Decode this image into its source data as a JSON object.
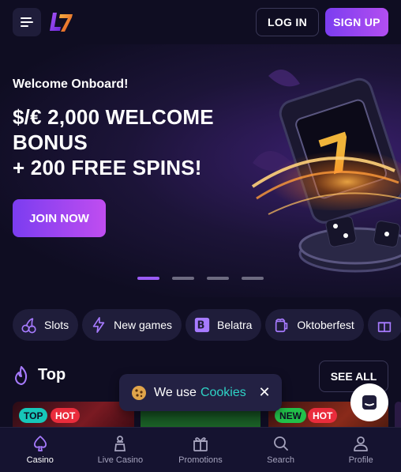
{
  "header": {
    "menu_icon": "hamburger-icon",
    "logo_text": "L7",
    "login_label": "LOG IN",
    "signup_label": "SIGN UP"
  },
  "hero": {
    "subtitle": "Welcome Onboard!",
    "title_line1": "$/€ 2,000 WELCOME",
    "title_line2": "BONUS",
    "title_line3": "+ 200 FREE SPINS!",
    "cta_label": "JOIN NOW",
    "slides_total": 4,
    "active_slide": 1
  },
  "categories": [
    {
      "label": "Slots",
      "icon": "cherries-icon"
    },
    {
      "label": "New games",
      "icon": "lightning-icon"
    },
    {
      "label": "Belatra",
      "icon": "belatra-logo-icon"
    },
    {
      "label": "Oktoberfest",
      "icon": "beer-mug-icon"
    },
    {
      "label": "",
      "icon": "gift-icon"
    }
  ],
  "top_section": {
    "title": "Top",
    "see_all_label": "SEE ALL",
    "cards": [
      {
        "badges": [
          "TOP",
          "HOT"
        ]
      },
      {
        "badges": []
      },
      {
        "badges": [
          "NEW",
          "HOT"
        ]
      }
    ]
  },
  "cookie": {
    "text": "We use",
    "link": "Cookies",
    "close": "✕"
  },
  "bottom_nav": [
    {
      "label": "Casino",
      "icon": "casino-spade-icon",
      "active": true
    },
    {
      "label": "Live Casino",
      "icon": "live-dealer-icon",
      "active": false
    },
    {
      "label": "Promotions",
      "icon": "gift-icon",
      "active": false
    },
    {
      "label": "Search",
      "icon": "search-icon",
      "active": false
    },
    {
      "label": "Profile",
      "icon": "profile-icon",
      "active": false
    }
  ],
  "colors": {
    "background": "#0f0d22",
    "accent_purple": "#9b5cf5",
    "chip_bg": "#1f1d3a",
    "cookie_link": "#2ed3c6"
  }
}
